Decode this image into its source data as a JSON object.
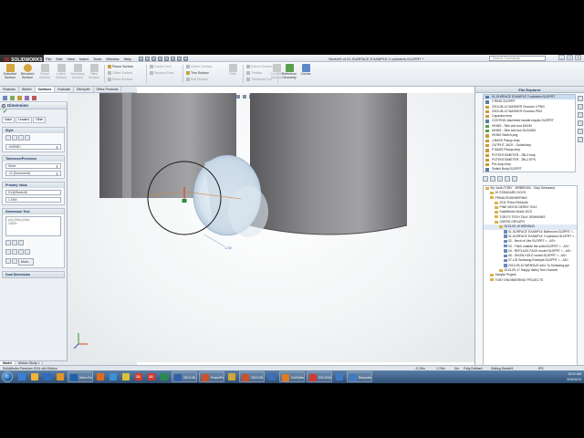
{
  "window": {
    "logo_text": "SOLIDWORKS",
    "logo_mark": "3S",
    "menus": [
      "File",
      "Edit",
      "View",
      "Insert",
      "Tools",
      "Window",
      "Help"
    ],
    "doc_title": "Sketch5 of 01-SURFACE EXAMPLE 2 cylinders.SLDPRT *",
    "search_placeholder": "Search Commands",
    "controls": [
      "_",
      "□",
      "×"
    ]
  },
  "ribbon": {
    "large_buttons": [
      {
        "label": "Extruded Surface",
        "icon": "extruded-surface-icon",
        "color": "#d6a640"
      },
      {
        "label": "Revolved Surface",
        "icon": "revolved-surface-icon",
        "color": "#d6a640"
      },
      {
        "label": "Swept Surface",
        "icon": "swept-surface-icon",
        "color": "#bdbdbd",
        "disabled": true
      },
      {
        "label": "Lofted Surface",
        "icon": "lofted-surface-icon",
        "color": "#bdbdbd",
        "disabled": true
      },
      {
        "label": "Boundary Surface",
        "icon": "boundary-surface-icon",
        "color": "#bdbdbd",
        "disabled": true
      },
      {
        "label": "Filled Surface",
        "icon": "filled-surface-icon",
        "color": "#bdbdbd",
        "disabled": true
      }
    ],
    "small_group_1": [
      "Planar Surface",
      "Offset Surface",
      "Ruled Surface"
    ],
    "small_group_2": [
      "Delete Face",
      "Replace Face"
    ],
    "small_group_3": [
      "Untrim Surface",
      "Trim Surface",
      "Knit Surface"
    ],
    "small_group_4": [
      "Extend Surface",
      "Thicken",
      "Thickened Cut"
    ],
    "extra_buttons": [
      {
        "label": "Fillet",
        "icon": "fillet-icon"
      },
      {
        "label": "Cut With Surface",
        "icon": "cut-with-surface-icon"
      }
    ],
    "right_buttons": [
      {
        "label": "Reference Geometry",
        "icon": "reference-geometry-icon",
        "color": "#5aa14e"
      },
      {
        "label": "Curves",
        "icon": "curves-icon",
        "color": "#5a88c8"
      }
    ]
  },
  "command_tabs": [
    "Features",
    "Sketch",
    "Surfaces",
    "Evaluate",
    "DimXpert",
    "Office Products"
  ],
  "active_command_tab": "Surfaces",
  "property_manager": {
    "title": "Dimension",
    "subtabs": [
      "Value",
      "Leaders",
      "Other"
    ],
    "groups": {
      "style": {
        "title": "Style",
        "field": "<NONE>"
      },
      "tolerance": {
        "title": "Tolerance/Precision",
        "fields": [
          "None",
          ".12 (Document)"
        ]
      },
      "primary_value": {
        "title": "Primary Value",
        "fields": [
          "D1@Sketch5",
          "1.00in"
        ]
      },
      "dimension_text": {
        "title": "Dimension Text",
        "field": "<DIM>",
        "area": "(xx) (Dim) (Dim)"
      },
      "dual_dimension": {
        "title": "Dual Dimension"
      }
    },
    "more_label": "More..."
  },
  "bottom_tabs": [
    "Model",
    "Motion Study 1"
  ],
  "viewport": {
    "dim_value": "1.00"
  },
  "task_pane": {
    "title": "File Explorer",
    "recent_files": [
      {
        "name": "01-SURFACE EXAMPLE 2 cylinders.SLDPRT",
        "type": "part",
        "selected": true
      },
      {
        "name": "2 RING.SLDPRT",
        "type": "part"
      },
      {
        "name": "2013-08-12 WASHER Grooves 2.PNG",
        "type": "img"
      },
      {
        "name": "2013-08-12 WASHER Grooves.PNG",
        "type": "img"
      },
      {
        "name": "Capacitor.bmp",
        "type": "img"
      },
      {
        "name": "COSTING-Machined handle maybe.SLDPRT",
        "type": "part"
      },
      {
        "name": "HKINS - Slim slot turn.EASM",
        "type": "grn"
      },
      {
        "name": "HKINS - Slim slot turn.SLDASM",
        "type": "grn"
      },
      {
        "name": "HKINS Sketch.png",
        "type": "img"
      },
      {
        "name": "J-BASS Pickup.bmp",
        "type": "img"
      },
      {
        "name": "OUTPUT JACK - Guitar.bmp",
        "type": "img"
      },
      {
        "name": "P-BASS Pickup.bmp",
        "type": "img"
      },
      {
        "name": "POTENTIOMETER - 2BL2.bmp",
        "type": "img"
      },
      {
        "name": "POTENTIOMETER - 2BL2.EPS",
        "type": "img"
      },
      {
        "name": "Pre-Amp.bmp",
        "type": "img"
      },
      {
        "name": "Switch Body.SLDPRT",
        "type": "part"
      }
    ],
    "tree": [
      {
        "indent": 0,
        "kind": "folder",
        "name": "My Vault (TOBY - MRBIEN94 - Toby Schnaars)"
      },
      {
        "indent": 1,
        "kind": "folder",
        "name": "00 STANDARD DOCS"
      },
      {
        "indent": 1,
        "kind": "folder",
        "name": "PRIMA ENGINEERING"
      },
      {
        "indent": 2,
        "kind": "folder",
        "name": "2011 Prism Refocals"
      },
      {
        "indent": 2,
        "kind": "folder",
        "name": "PINE WOOD DERBY 2012"
      },
      {
        "indent": 2,
        "kind": "folder",
        "name": "SolidWorks World 2013"
      },
      {
        "indent": 2,
        "kind": "folder",
        "name": "TOBY'S TECH TALK SEMINARS"
      },
      {
        "indent": 2,
        "kind": "folder",
        "name": "USERS GROUPS"
      },
      {
        "indent": 3,
        "kind": "folder",
        "name": "2013-09-10 WENSUG",
        "selected": true
      },
      {
        "indent": 4,
        "kind": "part",
        "name": "01-SURFACE EXAMPLE Bathroom.SLDPRT <..."
      },
      {
        "indent": 4,
        "kind": "part",
        "name": "01-SURFACE EXAMPLE 2 cylinders.SLDPRT <..."
      },
      {
        "indent": 4,
        "kind": "part",
        "name": "02 - Neck of Uke.SLDPRT < - AS>"
      },
      {
        "indent": 4,
        "kind": "part",
        "name": "03 - Think outside the solid.SLDPRT < - AS>"
      },
      {
        "indent": 4,
        "kind": "part",
        "name": "04 - REPLACE FACE model.SLDPRT < - AS>"
      },
      {
        "indent": 4,
        "kind": "part",
        "name": "06 - SHOW HOLE model.SLDPRT < - AS>"
      },
      {
        "indent": 4,
        "kind": "part",
        "name": "07-LID Surfacing Example.SLDPRT < - AS>"
      },
      {
        "indent": 4,
        "kind": "part",
        "name": "2013-09-10 WENSUG Intro To Surfacing.ppt"
      },
      {
        "indent": 3,
        "kind": "folder",
        "name": "2013-09-17 Happy Valley Tech Summit"
      },
      {
        "indent": 1,
        "kind": "folder",
        "name": "Sample Project"
      },
      {
        "indent": 1,
        "kind": "folder",
        "name": "TOBY ENGINEERING PROJECTS"
      }
    ]
  },
  "statusbar": {
    "left": "SolidWorks Premium 2014 x64 Edition",
    "coords": [
      "-0.29in",
      "1.76in",
      "0in"
    ],
    "state": "Fully Defined",
    "mode": "Editing Sketch5",
    "units": "IPS"
  },
  "taskbar": {
    "apps": [
      {
        "label": "",
        "color": "#3a7fd5"
      },
      {
        "label": "",
        "color": "#f0b23a"
      },
      {
        "label": "",
        "color": "#2b6cc4"
      },
      {
        "label": "",
        "color": "#e0962d"
      },
      {
        "label": "Micro Eng...",
        "color": "#1e5fae",
        "button": true
      },
      {
        "label": "",
        "color": "#e36a1b"
      },
      {
        "label": "",
        "color": "#3b8ed8"
      },
      {
        "label": "",
        "color": "#d6c235"
      },
      {
        "label": "13",
        "color": "#d23b2f"
      },
      {
        "label": "13",
        "color": "#d23b2f"
      },
      {
        "label": "",
        "color": "#2a8a4a"
      },
      {
        "label": "2013-08-1...",
        "color": "#2f5fa8",
        "button": true
      },
      {
        "label": "PowerPoin...",
        "color": "#c9512b",
        "button": true
      },
      {
        "label": "",
        "color": "#d3a63a"
      },
      {
        "label": "2013-08-...",
        "color": "#c9512b",
        "button": true
      },
      {
        "label": "",
        "color": "#3d6eb8"
      },
      {
        "label": "GoToMee...",
        "color": "#e07b1e",
        "button": true
      },
      {
        "label": "SW 2014...",
        "color": "#d23b2f",
        "button": true
      },
      {
        "label": "",
        "color": "#3e7ac2"
      },
      {
        "label": "Recording...",
        "color": "#3e7ac2",
        "button": true
      }
    ],
    "clock_time": "10:01 AM",
    "clock_date": "9/10/2013"
  }
}
